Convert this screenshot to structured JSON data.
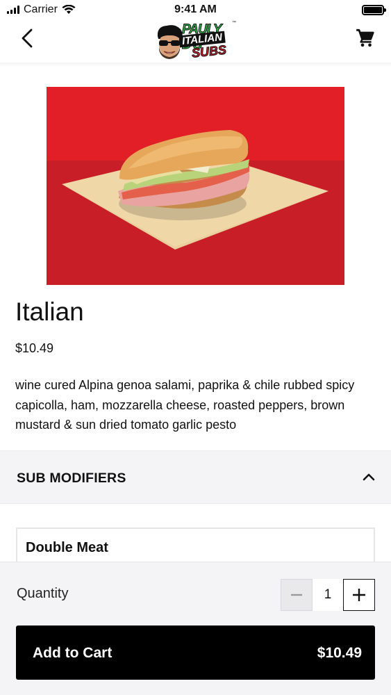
{
  "status_bar": {
    "carrier": "Carrier",
    "time": "9:41 AM"
  },
  "nav": {
    "logo": {
      "line1": "PAULY D'S",
      "line2": "ITALIAN",
      "line3": "SUBS",
      "tm": "™"
    },
    "back_icon": "chevron-left-icon",
    "cart_icon": "shopping-cart-icon"
  },
  "product": {
    "name": "Italian",
    "price": "$10.49",
    "description": "wine cured Alpina genoa salami, paprika & chile rubbed spicy capicolla, ham, mozzarella cheese, roasted peppers, brown mustard & sun dried tomato garlic pesto"
  },
  "modifiers": {
    "section_title": "SUB MODIFIERS",
    "expanded": true,
    "options": [
      {
        "title": "Double Meat"
      }
    ]
  },
  "cart": {
    "quantity_label": "Quantity",
    "quantity": "1",
    "add_label": "Add to Cart",
    "total": "$10.49"
  },
  "colors": {
    "hero_red_top": "#e21f26",
    "hero_red_bottom": "#c81e27",
    "button_bg": "#000000",
    "panel_bg": "#f4f4f6"
  }
}
